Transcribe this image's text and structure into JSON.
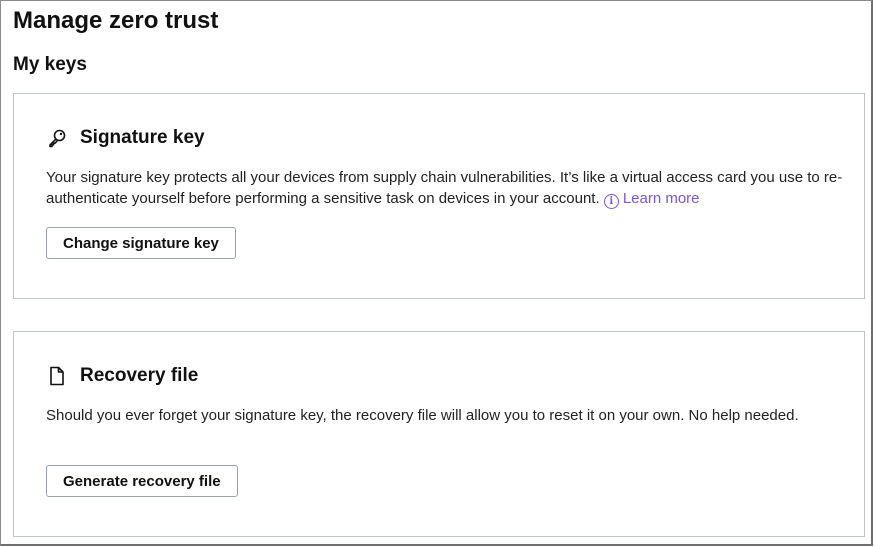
{
  "page": {
    "title": "Manage zero trust",
    "section_title": "My keys"
  },
  "signature_card": {
    "icon": "key-icon",
    "title": "Signature key",
    "description": "Your signature key protects all your devices from supply chain vulnerabilities. It’s like a virtual access card you use to re-authenticate yourself before performing a sensitive task on devices in your account.",
    "learn_more_label": "Learn more",
    "button_label": "Change signature key"
  },
  "recovery_card": {
    "icon": "file-icon",
    "title": "Recovery file",
    "description": "Should you ever forget your signature key, the recovery file will allow you to reset it on your own. No help needed.",
    "button_label": "Generate recovery file"
  },
  "colors": {
    "link": "#7b55d6",
    "border": "#bfc6cc"
  }
}
